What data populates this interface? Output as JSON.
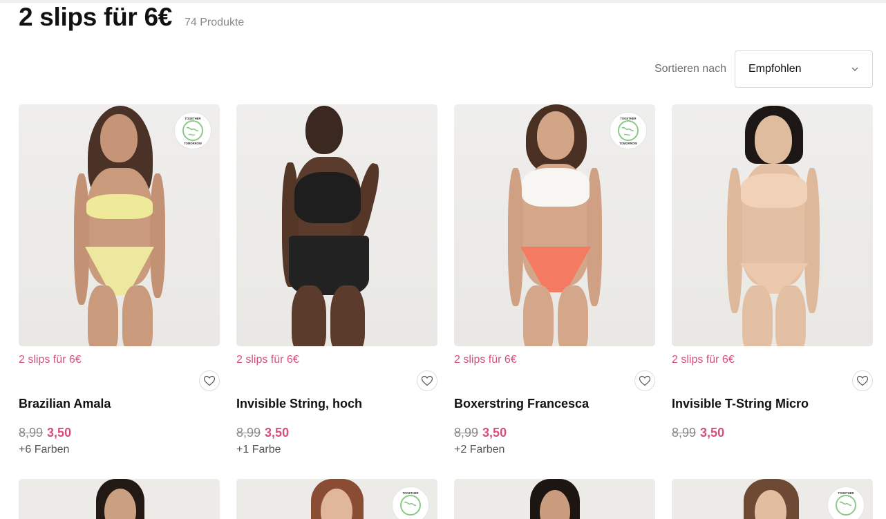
{
  "header": {
    "title": "2 slips für 6€",
    "count": "74 Produkte"
  },
  "sort": {
    "label": "Sortieren nach",
    "value": "Empfohlen"
  },
  "products": [
    {
      "promo": "2 slips für 6€",
      "name": "Brazilian Amala",
      "old_price": "8,99",
      "new_price": "3,50",
      "colors": "+6 Farben",
      "badge": true
    },
    {
      "promo": "2 slips für 6€",
      "name": "Invisible String, hoch",
      "old_price": "8,99",
      "new_price": "3,50",
      "colors": "+1 Farbe",
      "badge": false
    },
    {
      "promo": "2 slips für 6€",
      "name": "Boxerstring Francesca",
      "old_price": "8,99",
      "new_price": "3,50",
      "colors": "+2 Farben",
      "badge": true
    },
    {
      "promo": "2 slips für 6€",
      "name": "Invisible T-String Micro",
      "old_price": "8,99",
      "new_price": "3,50",
      "colors": "",
      "badge": false
    }
  ],
  "badge_text": {
    "top": "TOGETHER",
    "bottom": "TOMORROW"
  },
  "colors": {
    "accent": "#d4507d",
    "badge_green": "#8bc98a"
  }
}
